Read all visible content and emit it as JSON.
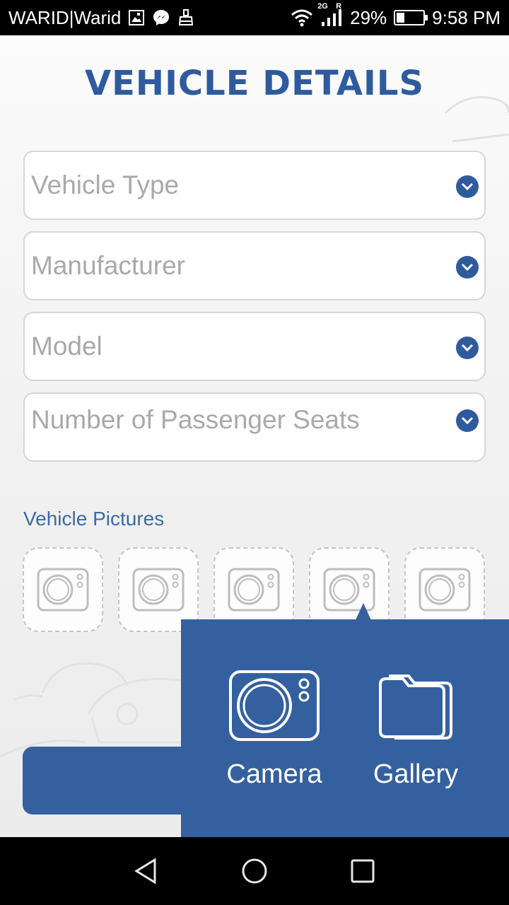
{
  "status_bar": {
    "carrier": "WARID|Warid",
    "network": "2G",
    "roaming": "R",
    "battery": "29%",
    "battery_level": 0.29,
    "time": "9:58 PM",
    "icons": [
      "gallery-icon",
      "messenger-icon",
      "cleaner-icon",
      "wifi-icon",
      "signal-icon",
      "battery-icon"
    ]
  },
  "page": {
    "title": "VEHICLE DETAILS"
  },
  "fields": [
    {
      "label": "Vehicle Type"
    },
    {
      "label": "Manufacturer"
    },
    {
      "label": "Model"
    },
    {
      "label": "Number of Passenger Seats"
    }
  ],
  "pictures": {
    "label": "Vehicle Pictures",
    "slots": 5
  },
  "popup": {
    "camera_label": "Camera",
    "gallery_label": "Gallery"
  },
  "colors": {
    "brand_blue": "#2f5b9e",
    "popup_blue": "#34609f",
    "placeholder_gray": "#a9a9a9"
  }
}
